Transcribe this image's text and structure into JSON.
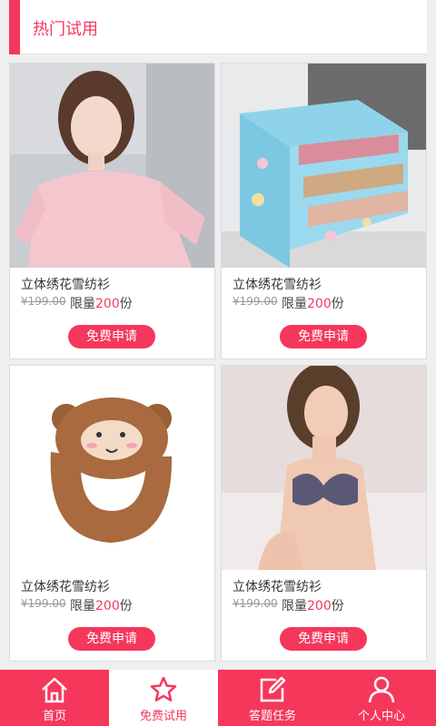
{
  "header": {
    "title": "热门试用"
  },
  "products": [
    {
      "name": "立体绣花雪纺衫",
      "old_price": "¥199.00",
      "limit_prefix": "限量",
      "limit_num": "200",
      "limit_suffix": "份",
      "apply_label": "免费申请",
      "image": "pink-blouse-photo"
    },
    {
      "name": "立体绣花雪纺衫",
      "old_price": "¥199.00",
      "limit_prefix": "限量",
      "limit_num": "200",
      "limit_suffix": "份",
      "apply_label": "免费申请",
      "image": "storage-drawers-photo"
    },
    {
      "name": "立体绣花雪纺衫",
      "old_price": "¥199.00",
      "limit_prefix": "限量",
      "limit_num": "200",
      "limit_suffix": "份",
      "apply_label": "免费申请",
      "image": "monkey-neck-pillow-photo"
    },
    {
      "name": "立体绣花雪纺衫",
      "old_price": "¥199.00",
      "limit_prefix": "限量",
      "limit_num": "200",
      "limit_suffix": "份",
      "apply_label": "免费申请",
      "image": "lingerie-model-photo"
    }
  ],
  "tabs": [
    {
      "label": "首页",
      "icon": "home-icon"
    },
    {
      "label": "免费试用",
      "icon": "star-icon",
      "active": true
    },
    {
      "label": "答题任务",
      "icon": "edit-icon"
    },
    {
      "label": "个人中心",
      "icon": "person-icon"
    }
  ],
  "colors": {
    "accent": "#f5375c",
    "background": "#efefef"
  }
}
